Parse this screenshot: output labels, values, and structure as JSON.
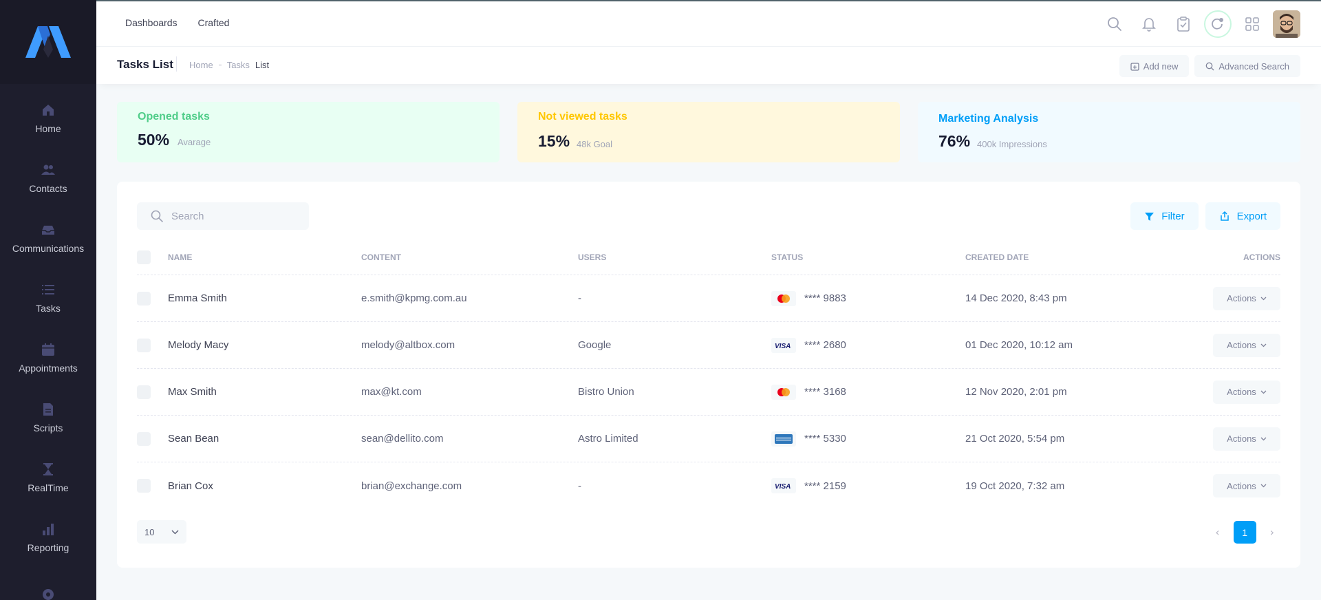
{
  "sidebar": {
    "items": [
      {
        "label": "Home",
        "icon": "home-icon"
      },
      {
        "label": "Contacts",
        "icon": "contacts-icon"
      },
      {
        "label": "Communications",
        "icon": "inbox-icon"
      },
      {
        "label": "Tasks",
        "icon": "list-icon"
      },
      {
        "label": "Appointments",
        "icon": "calendar-icon"
      },
      {
        "label": "Scripts",
        "icon": "document-icon"
      },
      {
        "label": "RealTime",
        "icon": "hourglass-icon"
      },
      {
        "label": "Reporting",
        "icon": "bar-chart-icon"
      }
    ]
  },
  "header": {
    "nav": [
      "Dashboards",
      "Crafted"
    ]
  },
  "toolbar": {
    "title": "Tasks List",
    "breadcrumb": [
      "Home",
      "Tasks",
      "List"
    ],
    "add_new": "Add new",
    "advanced_search": "Advanced Search"
  },
  "stats": [
    {
      "title": "Opened tasks",
      "value": "50%",
      "sub": "Avarage",
      "color": "#50cd89",
      "bg": "#e8fff3"
    },
    {
      "title": "Not viewed tasks",
      "value": "15%",
      "sub": "48k Goal",
      "color": "#ffc700",
      "bg": "#fff8dd"
    },
    {
      "title": "Marketing Analysis",
      "value": "76%",
      "sub": "400k Impressions",
      "color": "#009ef7",
      "bg": "#f1faff"
    }
  ],
  "table": {
    "search_placeholder": "Search",
    "filter": "Filter",
    "export": "Export",
    "columns": [
      "Name",
      "Content",
      "Users",
      "Status",
      "Created Date",
      "Actions"
    ],
    "rows": [
      {
        "name": "Emma Smith",
        "content": "e.smith@kpmg.com.au",
        "users": "-",
        "card": "mastercard",
        "status": "**** 9883",
        "date": "14 Dec 2020, 8:43 pm",
        "action": "Actions"
      },
      {
        "name": "Melody Macy",
        "content": "melody@altbox.com",
        "users": "Google",
        "card": "visa",
        "status": "**** 2680",
        "date": "01 Dec 2020, 10:12 am",
        "action": "Actions"
      },
      {
        "name": "Max Smith",
        "content": "max@kt.com",
        "users": "Bistro Union",
        "card": "mastercard",
        "status": "**** 3168",
        "date": "12 Nov 2020, 2:01 pm",
        "action": "Actions"
      },
      {
        "name": "Sean Bean",
        "content": "sean@dellito.com",
        "users": "Astro Limited",
        "card": "amex",
        "status": "**** 5330",
        "date": "21 Oct 2020, 5:54 pm",
        "action": "Actions"
      },
      {
        "name": "Brian Cox",
        "content": "brian@exchange.com",
        "users": "-",
        "card": "visa",
        "status": "**** 2159",
        "date": "19 Oct 2020, 7:32 am",
        "action": "Actions"
      }
    ],
    "page_size": "10",
    "current_page": "1"
  }
}
